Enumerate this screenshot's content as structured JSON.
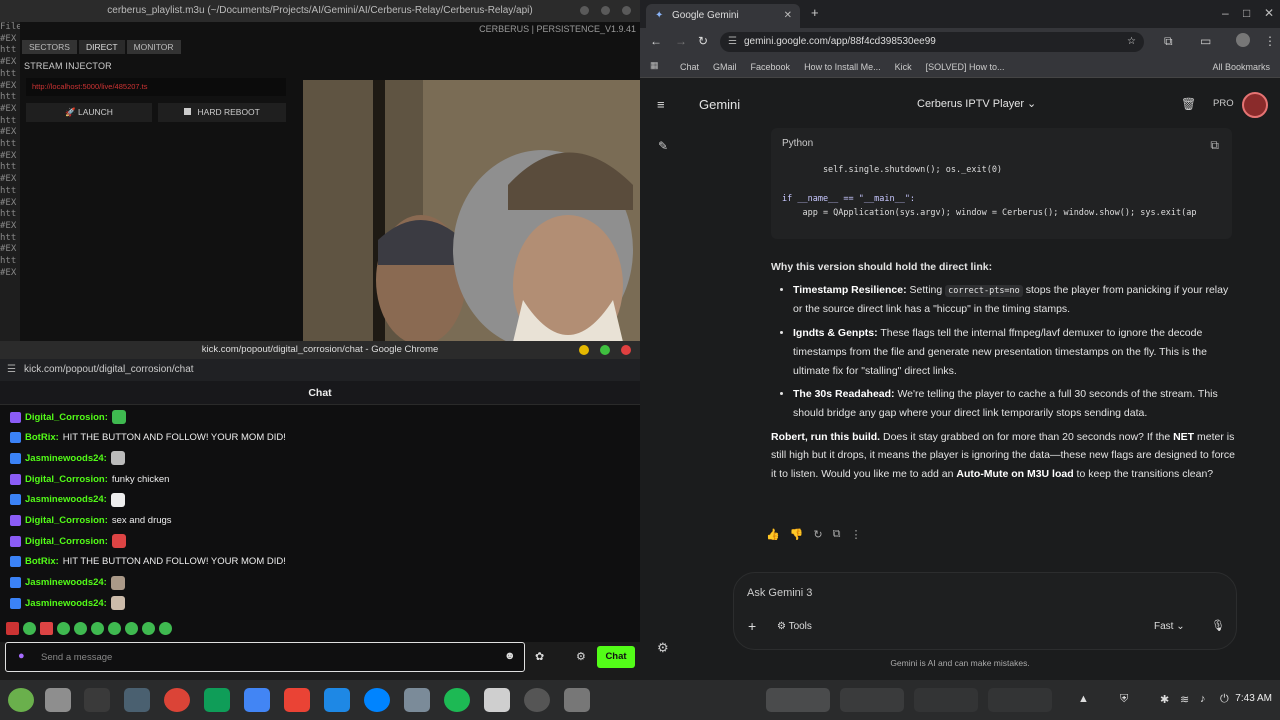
{
  "editor": {
    "title": "cerberus_playlist.m3u (~/Documents/Projects/AI/Gemini/AI/Cerberus-Relay/Cerberus-Relay/api)",
    "gutter": [
      "File",
      "",
      "",
      "#EX",
      "htt",
      "#EX",
      "htt",
      "#EX",
      "htt",
      "#EX",
      "htt",
      "#EX",
      "htt",
      "#EX",
      "htt",
      "#EX",
      "htt",
      "#EX",
      "htt",
      "#EX",
      "htt",
      "#EX",
      "htt",
      "#EX"
    ]
  },
  "cerberus": {
    "version": "CERBERUS | PERSISTENCE_V1.9.41",
    "tabs": [
      "SECTORS",
      "DIRECT",
      "MONITOR"
    ],
    "injector_label": "STREAM INJECTOR",
    "url_value": "http://localhost:5000/live/485207.ts",
    "launch_label": "LAUNCH",
    "reboot_label": "HARD REBOOT"
  },
  "kick": {
    "window_title": "kick.com/popout/digital_corrosion/chat - Google Chrome",
    "url": "kick.com/popout/digital_corrosion/chat",
    "header": "Chat",
    "messages": [
      {
        "user": "Digital_Corrosion:",
        "text": "",
        "user_color": "#53fc18",
        "badge_color": "#8b5cf6",
        "emote_color": "#3fb950"
      },
      {
        "user": "BotRix:",
        "text": "HIT THE BUTTON AND FOLLOW! YOUR MOM DID!",
        "user_color": "#53fc18",
        "badge_color": "#3b82f6",
        "emote_color": ""
      },
      {
        "user": "Jasminewoods24:",
        "text": "",
        "user_color": "#53fc18",
        "badge_color": "#3b82f6",
        "emote_color": "#bbb"
      },
      {
        "user": "Digital_Corrosion:",
        "text": "funky chicken",
        "user_color": "#53fc18",
        "badge_color": "#8b5cf6",
        "emote_color": ""
      },
      {
        "user": "Jasminewoods24:",
        "text": "",
        "user_color": "#53fc18",
        "badge_color": "#3b82f6",
        "emote_color": "#eee"
      },
      {
        "user": "Digital_Corrosion:",
        "text": "sex and drugs",
        "user_color": "#53fc18",
        "badge_color": "#8b5cf6",
        "emote_color": ""
      },
      {
        "user": "Digital_Corrosion:",
        "text": "",
        "user_color": "#53fc18",
        "badge_color": "#8b5cf6",
        "emote_color": "#d44"
      },
      {
        "user": "BotRix:",
        "text": "HIT THE BUTTON AND FOLLOW! YOUR MOM DID!",
        "user_color": "#53fc18",
        "badge_color": "#3b82f6",
        "emote_color": ""
      },
      {
        "user": "Jasminewoods24:",
        "text": "",
        "user_color": "#53fc18",
        "badge_color": "#3b82f6",
        "emote_color": "#a98"
      },
      {
        "user": "Jasminewoods24:",
        "text": "",
        "user_color": "#53fc18",
        "badge_color": "#3b82f6",
        "emote_color": "#cba"
      }
    ],
    "input_placeholder": "Send a message",
    "send_label": "Chat"
  },
  "gemini": {
    "tab_title": "Google Gemini",
    "url": "gemini.google.com/app/88f4cd398530ee99",
    "bookmarks": [
      "Chat",
      "GMail",
      "Facebook",
      "How to Install Me...",
      "Kick",
      "[SOLVED] How to...",
      "All Bookmarks"
    ],
    "brand": "Gemini",
    "conversation_title": "Cerberus IPTV Player",
    "pro_label": "PRO",
    "code": {
      "language": "Python",
      "lines": [
        "        self.single.shutdown(); os._exit(0)",
        "",
        "if __name__ == \"__main__\":",
        "    app = QApplication(sys.argv); window = Cerberus(); window.show(); sys.exit(ap"
      ]
    },
    "heading": "Why this version should hold the direct link:",
    "bullets": [
      {
        "bold": "Timestamp Resilience:",
        "pre": " Setting ",
        "code": "correct-pts=no",
        "post": " stops the player from panicking if your relay or the source direct link has a \"hiccup\" in the timing stamps."
      },
      {
        "bold": "Igndts & Genpts:",
        "pre": " These flags tell the internal ffmpeg/lavf demuxer to ignore the decode timestamps from the file and generate new presentation timestamps on the fly. This is the ultimate fix for \"stalling\" direct links.",
        "code": "",
        "post": ""
      },
      {
        "bold": "The 30s Readahead:",
        "pre": " We're telling the player to cache a full 30 seconds of the stream. This should bridge any gap where your direct link temporarily stops sending data.",
        "code": "",
        "post": ""
      }
    ],
    "closing": {
      "b1": "Robert, run this build.",
      "t1": " Does it stay grabbed on for more than 20 seconds now? If the ",
      "b2": "NET",
      "t2": " meter is still high but it drops, it means the player is ignoring the data—these new flags are designed to force it to listen. Would you like me to add an ",
      "b3": "Auto-Mute on M3U load",
      "t3": " to keep the transitions clean?"
    },
    "ask_placeholder": "Ask Gemini 3",
    "tools_label": "Tools",
    "mode_label": "Fast",
    "disclaimer": "Gemini is AI and can make mistakes."
  },
  "taskbar": {
    "clock": "7:43 AM"
  }
}
